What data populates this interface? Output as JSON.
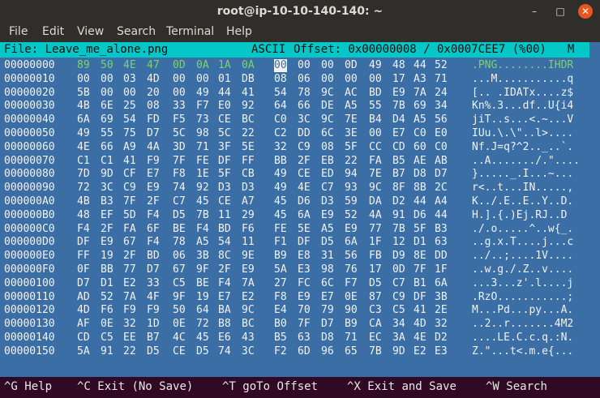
{
  "window": {
    "title": "root@ip-10-10-140-140: ~",
    "min": "–",
    "max": "□",
    "close": "✕"
  },
  "menu": [
    "File",
    "Edit",
    "View",
    "Search",
    "Terminal",
    "Help"
  ],
  "status": {
    "file": "File: Leave_me_alone.png",
    "ascii": "ASCII",
    "offset": "Offset: 0x00000008 / 0x0007CEE7 (%00)",
    "mode": "M"
  },
  "rows": [
    {
      "off": "00000000",
      "hex": [
        "89",
        "50",
        "4E",
        "47",
        "0D",
        "0A",
        "1A",
        "0A",
        "00",
        "00",
        "00",
        "0D",
        "49",
        "48",
        "44",
        "52"
      ],
      "ascii": ".PNG........IHDR"
    },
    {
      "off": "00000010",
      "hex": [
        "00",
        "00",
        "03",
        "4D",
        "00",
        "00",
        "01",
        "DB",
        "08",
        "06",
        "00",
        "00",
        "00",
        "17",
        "A3",
        "71"
      ],
      "ascii": "...M...........q"
    },
    {
      "off": "00000020",
      "hex": [
        "5B",
        "00",
        "00",
        "20",
        "00",
        "49",
        "44",
        "41",
        "54",
        "78",
        "9C",
        "AC",
        "BD",
        "E9",
        "7A",
        "24"
      ],
      "ascii": "[.. .IDATx....z$"
    },
    {
      "off": "00000030",
      "hex": [
        "4B",
        "6E",
        "25",
        "08",
        "33",
        "F7",
        "E0",
        "92",
        "64",
        "66",
        "DE",
        "A5",
        "55",
        "7B",
        "69",
        "34"
      ],
      "ascii": "Kn%.3...df..U{i4"
    },
    {
      "off": "00000040",
      "hex": [
        "6A",
        "69",
        "54",
        "FD",
        "F5",
        "73",
        "CE",
        "BC",
        "C0",
        "3C",
        "9C",
        "7E",
        "B4",
        "D4",
        "A5",
        "56"
      ],
      "ascii": "jiT..s...<.~...V"
    },
    {
      "off": "00000050",
      "hex": [
        "49",
        "55",
        "75",
        "D7",
        "5C",
        "98",
        "5C",
        "22",
        "C2",
        "DD",
        "6C",
        "3E",
        "00",
        "E7",
        "C0",
        "E0"
      ],
      "ascii": "IUu.\\.\\\"..l>...."
    },
    {
      "off": "00000060",
      "hex": [
        "4E",
        "66",
        "A9",
        "4A",
        "3D",
        "71",
        "3F",
        "5E",
        "32",
        "C9",
        "08",
        "5F",
        "CC",
        "CD",
        "60",
        "C0"
      ],
      "ascii": "Nf.J=q?^2.._..`."
    },
    {
      "off": "00000070",
      "hex": [
        "C1",
        "C1",
        "41",
        "F9",
        "7F",
        "FE",
        "DF",
        "FF",
        "BB",
        "2F",
        "EB",
        "22",
        "FA",
        "B5",
        "AE",
        "AB"
      ],
      "ascii": "..A......./.\"...."
    },
    {
      "off": "00000080",
      "hex": [
        "7D",
        "9D",
        "CF",
        "E7",
        "F8",
        "1E",
        "5F",
        "CB",
        "49",
        "CE",
        "ED",
        "94",
        "7E",
        "B7",
        "D8",
        "D7"
      ],
      "ascii": "}....._.I...~..."
    },
    {
      "off": "00000090",
      "hex": [
        "72",
        "3C",
        "C9",
        "E9",
        "74",
        "92",
        "D3",
        "D3",
        "49",
        "4E",
        "C7",
        "93",
        "9C",
        "8F",
        "8B",
        "2C"
      ],
      "ascii": "r<..t...IN.....,"
    },
    {
      "off": "000000A0",
      "hex": [
        "4B",
        "B3",
        "7F",
        "2F",
        "C7",
        "45",
        "CE",
        "A7",
        "45",
        "D6",
        "D3",
        "59",
        "DA",
        "D2",
        "44",
        "A4"
      ],
      "ascii": "K../.E..E..Y..D."
    },
    {
      "off": "000000B0",
      "hex": [
        "48",
        "EF",
        "5D",
        "F4",
        "D5",
        "7B",
        "11",
        "29",
        "45",
        "6A",
        "E9",
        "52",
        "4A",
        "91",
        "D6",
        "44"
      ],
      "ascii": "H.].{.)Ej.RJ..D"
    },
    {
      "off": "000000C0",
      "hex": [
        "F4",
        "2F",
        "FA",
        "6F",
        "BE",
        "F4",
        "BD",
        "F6",
        "FE",
        "5E",
        "A5",
        "E9",
        "77",
        "7B",
        "5F",
        "B3"
      ],
      "ascii": "./.o.....^..w{_."
    },
    {
      "off": "000000D0",
      "hex": [
        "DF",
        "E9",
        "67",
        "F4",
        "78",
        "A5",
        "54",
        "11",
        "F1",
        "DF",
        "D5",
        "6A",
        "1F",
        "12",
        "D1",
        "63"
      ],
      "ascii": "..g.x.T....j...c"
    },
    {
      "off": "000000E0",
      "hex": [
        "FF",
        "19",
        "2F",
        "BD",
        "06",
        "3B",
        "8C",
        "9E",
        "B9",
        "E8",
        "31",
        "56",
        "FB",
        "D9",
        "8E",
        "DD"
      ],
      "ascii": "../..;....1V...."
    },
    {
      "off": "000000F0",
      "hex": [
        "0F",
        "BB",
        "77",
        "D7",
        "67",
        "9F",
        "2F",
        "E9",
        "5A",
        "E3",
        "98",
        "76",
        "17",
        "0D",
        "7F",
        "1F"
      ],
      "ascii": "..w.g./.Z..v...."
    },
    {
      "off": "00000100",
      "hex": [
        "D7",
        "D1",
        "E2",
        "33",
        "C5",
        "BE",
        "F4",
        "7A",
        "27",
        "FC",
        "6C",
        "F7",
        "D5",
        "C7",
        "B1",
        "6A"
      ],
      "ascii": "...3...z'.l....j"
    },
    {
      "off": "00000110",
      "hex": [
        "AD",
        "52",
        "7A",
        "4F",
        "9F",
        "19",
        "E7",
        "E2",
        "F8",
        "E9",
        "E7",
        "0E",
        "87",
        "C9",
        "DF",
        "3B"
      ],
      "ascii": ".RzO...........;"
    },
    {
      "off": "00000120",
      "hex": [
        "4D",
        "F6",
        "F9",
        "F9",
        "50",
        "64",
        "BA",
        "9C",
        "E4",
        "70",
        "79",
        "90",
        "C3",
        "C5",
        "41",
        "2E"
      ],
      "ascii": "M...Pd...py...A."
    },
    {
      "off": "00000130",
      "hex": [
        "AF",
        "0E",
        "32",
        "1D",
        "0E",
        "72",
        "B8",
        "BC",
        "B0",
        "7F",
        "D7",
        "B9",
        "CA",
        "34",
        "4D",
        "32"
      ],
      "ascii": "..2..r.......4M2"
    },
    {
      "off": "00000140",
      "hex": [
        "CD",
        "C5",
        "EE",
        "B7",
        "4C",
        "45",
        "E6",
        "43",
        "B5",
        "63",
        "D8",
        "71",
        "EC",
        "3A",
        "4E",
        "D2"
      ],
      "ascii": "....LE.C.c.q.:N."
    },
    {
      "off": "00000150",
      "hex": [
        "5A",
        "91",
        "22",
        "D5",
        "CE",
        "D5",
        "74",
        "3C",
        "F2",
        "6D",
        "96",
        "65",
        "7B",
        "9D",
        "E2",
        "E3"
      ],
      "ascii": "Z.\"...t<.m.e{..."
    }
  ],
  "footer": [
    {
      "key": "^G",
      "label": "Help"
    },
    {
      "key": "^C",
      "label": "Exit (No Save)"
    },
    {
      "key": "^T",
      "label": "goTo Offset"
    },
    {
      "key": "^X",
      "label": "Exit and Save"
    },
    {
      "key": "^W",
      "label": "Search"
    }
  ],
  "colors": {
    "terminal_bg": "#3a6ea5",
    "status_bg": "#04c7c7",
    "highlight": "#7bd36f",
    "close_btn": "#e9541f"
  }
}
